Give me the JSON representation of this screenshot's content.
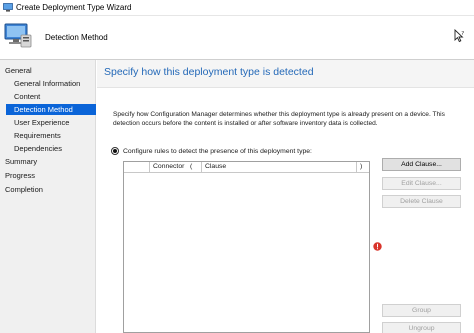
{
  "window": {
    "title": "Create Deployment Type Wizard"
  },
  "header": {
    "step_title": "Detection Method",
    "icons": {
      "wizard": "computer-wizard-icon",
      "help": "help-cursor-icon"
    }
  },
  "nav": {
    "items": [
      {
        "label": "General",
        "indent": 0,
        "active": false
      },
      {
        "label": "General Information",
        "indent": 1,
        "active": false
      },
      {
        "label": "Content",
        "indent": 1,
        "active": false
      },
      {
        "label": "Detection Method",
        "indent": 1,
        "active": true
      },
      {
        "label": "User Experience",
        "indent": 1,
        "active": false
      },
      {
        "label": "Requirements",
        "indent": 1,
        "active": false
      },
      {
        "label": "Dependencies",
        "indent": 1,
        "active": false
      },
      {
        "label": "Summary",
        "indent": 0,
        "active": false
      },
      {
        "label": "Progress",
        "indent": 0,
        "active": false
      },
      {
        "label": "Completion",
        "indent": 0,
        "active": false
      }
    ]
  },
  "main": {
    "heading": "Specify how this deployment type is detected",
    "description": "Specify how Configuration Manager determines whether this deployment type is already present on a device. This detection occurs before the content is installed or after software inventory data is collected.",
    "radio_label": "Configure rules to detect the presence of this deployment type:",
    "radio_selected": true,
    "table": {
      "columns": [
        {
          "label": ""
        },
        {
          "label": "Connector"
        },
        {
          "label": "("
        },
        {
          "label": "Clause"
        },
        {
          "label": ")"
        }
      ],
      "rows": []
    },
    "buttons": {
      "add_clause": "Add Clause...",
      "edit_clause": "Edit Clause...",
      "delete_clause": "Delete Clause",
      "group": "Group",
      "ungroup": "Ungroup"
    },
    "colors": {
      "accent": "#0a64d8",
      "heading": "#2469b8",
      "warning": "#d9342b"
    }
  }
}
